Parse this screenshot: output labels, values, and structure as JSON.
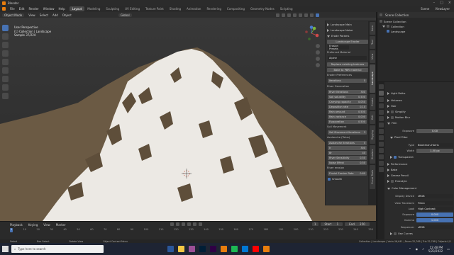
{
  "app": {
    "title": "Blender"
  },
  "menubar": {
    "items": [
      "File",
      "Edit",
      "Render",
      "Window",
      "Help"
    ],
    "workspaces": [
      "Layout",
      "Modeling",
      "Sculpting",
      "UV Editing",
      "Texture Paint",
      "Shading",
      "Animation",
      "Rendering",
      "Compositing",
      "Geometry Nodes",
      "Scripting"
    ],
    "active_workspace": "Layout",
    "scene_label": "Scene",
    "viewlayer_label": "ViewLayer"
  },
  "header": {
    "mode": "Object Mode",
    "menus": [
      "View",
      "Select",
      "Add",
      "Object"
    ],
    "transform": "Global"
  },
  "viewport": {
    "info_lines": [
      "User Perspective",
      "(1) Collection | Landscape",
      "Sample 37/224"
    ]
  },
  "npanel": {
    "landscape_main": "Landscape Main",
    "landscape_noise": "Landscape Noise",
    "erode_params": "Erode Params",
    "landscape_eroder": "Landscape Eroder",
    "erosion_presets": "Erosion Presets",
    "preferred_material": "Preferred Material",
    "material_value": "Alpine",
    "replace_btn": "Replace existing textures",
    "bake_btn": "Bake to PBR material",
    "eroder_prefs": "Eroder Preferences",
    "iterations_label": "Iterations",
    "iterations_value": "5",
    "river_generation": "River Generation",
    "river_fields": [
      {
        "label": "River Iterations",
        "value": "300"
      },
      {
        "label": "Soil solubility",
        "value": "0.500"
      },
      {
        "label": "Carrying capacity",
        "value": "0.050"
      },
      {
        "label": "Deposition rate",
        "value": "0.10"
      },
      {
        "label": "Rain amount",
        "value": "0.500"
      },
      {
        "label": "Rain variance",
        "value": "0.000"
      },
      {
        "label": "Evaporation",
        "value": "0.500"
      }
    ],
    "soil_movement": "Soil Movement",
    "soil_fields": [
      {
        "label": "Soil Movement Iterations",
        "value": "3"
      }
    ],
    "avalanche": "Avalanche (Talus)",
    "avalanche_fields": [
      {
        "label": "Avalanche Iterations",
        "value": "5"
      },
      {
        "label": "Ir",
        "value": "300"
      },
      {
        "label": "Br",
        "value": "40"
      },
      {
        "label": "River Sensitivity",
        "value": "0.50"
      },
      {
        "label": "Noise Effect",
        "value": "0.50"
      }
    ],
    "river_erosion": "River erosion",
    "river_erosion_fields": [
      {
        "label": "Fluvial Erosion Rate",
        "value": "0.60"
      }
    ],
    "smooth_label": "Smooth"
  },
  "sidetabs": [
    "Item",
    "Tool",
    "View",
    "Landscape",
    "Create",
    "Edit",
    "Rigging",
    "Shaders",
    "Curve Tools"
  ],
  "timeline": {
    "menus": [
      "Playback",
      "Keying",
      "View",
      "Marker"
    ],
    "current_frame": "1",
    "start_label": "Start",
    "start": "1",
    "end_label": "End",
    "end": "250",
    "ruler": [
      "1",
      "10",
      "20",
      "30",
      "40",
      "50",
      "60",
      "70",
      "80",
      "90",
      "100",
      "110",
      "120",
      "130",
      "140",
      "150",
      "160",
      "170",
      "180",
      "190",
      "200",
      "210",
      "220",
      "230",
      "240",
      "250"
    ]
  },
  "statusbar": {
    "items": [
      "Select",
      "Box Select",
      "Rotate View",
      "Object Context Menu",
      "Collection | Landscape | Verts:16,641 | Faces:32,768 | Tris:32,768 | Objects:1/1"
    ]
  },
  "outliner": {
    "header": "Scene Collection",
    "rows": [
      "Scene Collection",
      "Collection",
      "Landscape"
    ]
  },
  "properties": {
    "sections": {
      "light_paths": "Light Paths",
      "volumes": "Volumes",
      "hair": "Hair",
      "simplify": "Simplify",
      "motion_blur": "Motion Blur",
      "film": "Film",
      "exposure_label": "Exposure",
      "exposure_value": "0.00",
      "pixel_filter": "Pixel Filter",
      "type_label": "Type",
      "type_value": "Blackman-Harris",
      "width_label": "Width",
      "width_value": "1.50 px",
      "transparent": "Transparent",
      "performance": "Performance",
      "bake": "Bake",
      "grease_pencil": "Grease Pencil",
      "freestyle": "Freestyle",
      "color_management": "Color Management",
      "display_device_label": "Display Device",
      "display_device_value": "sRGB",
      "view_transform_label": "View Transform",
      "view_transform_value": "Filmic",
      "look_label": "Look",
      "look_value": "High Contrast",
      "cm_exposure_label": "Exposure",
      "cm_exposure_value": "0.000",
      "gamma_label": "Gamma",
      "gamma_value": "1.000",
      "sequencer_label": "Sequencer",
      "sequencer_value": "sRGB",
      "use_curves": "Use Curves"
    }
  },
  "taskbar": {
    "search_placeholder": "Type here to search",
    "time": "12:48 PM",
    "date": "5/23/2022",
    "icon_colors": [
      "#2b579a",
      "#f2c744",
      "#9b4f96",
      "#001e36",
      "#2f0045",
      "#e87d0d",
      "#1db954",
      "#0078d4",
      "#ff0000",
      "#e87d0d"
    ]
  },
  "colors": {
    "accent": "#4772b3",
    "blender_orange": "#e87d0d",
    "snow": "#ece9e4",
    "rock": "#6b5a44"
  }
}
